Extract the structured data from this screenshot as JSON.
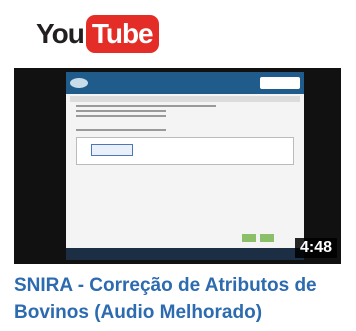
{
  "logo": {
    "you": "You",
    "tube": "Tube"
  },
  "video": {
    "duration": "4:48",
    "title": "SNIRA - Correção de Atributos de Bovinos (Audio Melhorado)"
  },
  "colors": {
    "brand_red": "#e52d27",
    "title_blue": "#2c6bb0"
  }
}
